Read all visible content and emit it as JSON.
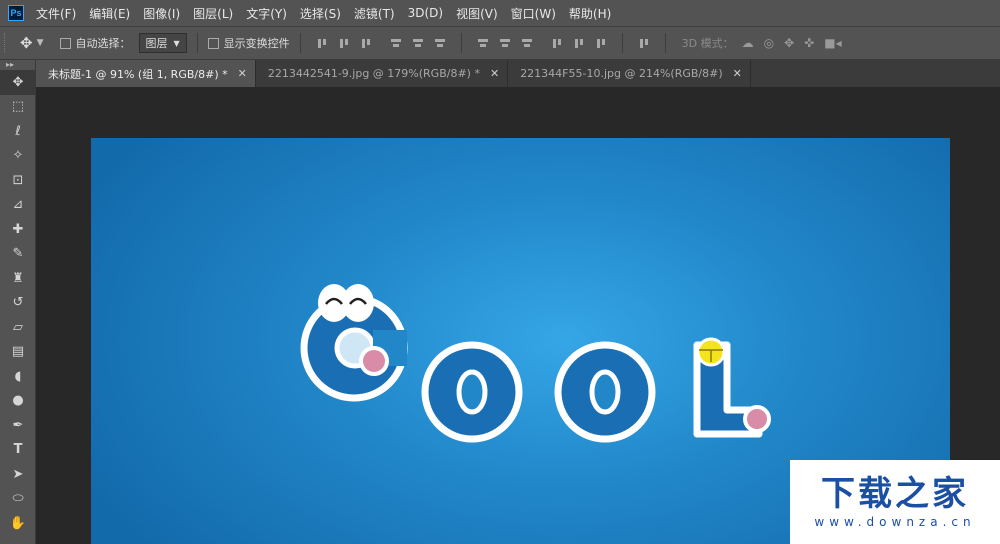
{
  "app": {
    "logo": "Ps"
  },
  "menu": [
    "文件(F)",
    "编辑(E)",
    "图像(I)",
    "图层(L)",
    "文字(Y)",
    "选择(S)",
    "滤镜(T)",
    "3D(D)",
    "视图(V)",
    "窗口(W)",
    "帮助(H)"
  ],
  "options": {
    "auto_select_label": "自动选择：",
    "auto_select_value": "图层",
    "show_transform_label": "显示变换控件",
    "mode_3d_label": "3D 模式："
  },
  "tabs": [
    {
      "label": "未标题-1 @ 91% (组 1, RGB/8#) *",
      "active": true
    },
    {
      "label": "2213442541-9.jpg @ 179%(RGB/8#) *",
      "active": false
    },
    {
      "label": "221344F55-10.jpg @ 214%(RGB/8#)",
      "active": false
    }
  ],
  "artwork": {
    "letters": [
      "C",
      "O",
      "O",
      "L"
    ]
  },
  "watermark": {
    "title": "下载之家",
    "url": "www.downza.cn"
  },
  "colors": {
    "ui_panel": "#535353",
    "canvas_blue": "#2187c9",
    "letter_blue": "#1a6fb4",
    "cheek_pink": "#d98ca8",
    "bell_yellow": "#f4e41c"
  }
}
